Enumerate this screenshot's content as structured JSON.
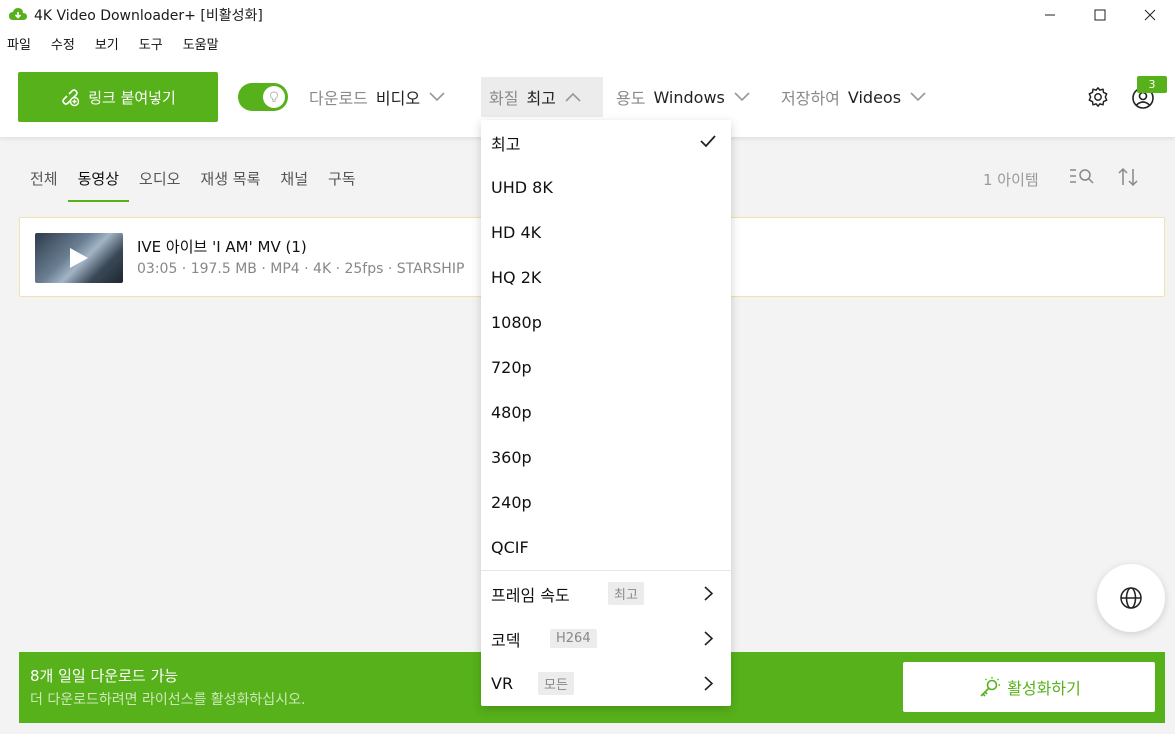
{
  "window": {
    "title": "4K Video Downloader+ [비활성화]",
    "brand_color": "#57b11a"
  },
  "menu": [
    "파일",
    "수정",
    "보기",
    "도구",
    "도움말"
  ],
  "toolbar": {
    "paste_label": "링크 붙여넣기",
    "smart_mode": "on",
    "download_label": "다운로드",
    "download_value": "비디오",
    "quality_label": "화질",
    "quality_value": "최고",
    "purpose_label": "용도",
    "purpose_value": "Windows",
    "save_label": "저장하여",
    "save_value": "Videos",
    "notification_count": "3"
  },
  "tabs": [
    {
      "label": "전체",
      "active": false
    },
    {
      "label": "동영상",
      "active": true
    },
    {
      "label": "오디오",
      "active": false
    },
    {
      "label": "재생 목록",
      "active": false
    },
    {
      "label": "채널",
      "active": false
    },
    {
      "label": "구독",
      "active": false
    }
  ],
  "item_count": "1 아이템",
  "items": [
    {
      "title": "IVE 아이브 'I AM' MV (1)",
      "meta": "03:05 · 197.5 MB · MP4 · 4K · 25fps · STARSHIP"
    }
  ],
  "quality_dropdown": {
    "options": [
      "최고",
      "UHD 8K",
      "HD 4K",
      "HQ 2K",
      "1080p",
      "720p",
      "480p",
      "360p",
      "240p",
      "QCIF"
    ],
    "selected": "최고",
    "submenus": [
      {
        "label": "프레임 속도",
        "value": "최고"
      },
      {
        "label": "코덱",
        "value": "H264"
      },
      {
        "label": "VR",
        "value": "모든"
      }
    ]
  },
  "banner": {
    "title": "8개 일일 다운로드 가능",
    "subtitle": "더 다운로드하려면 라이선스를 활성화하십시오.",
    "activate_label": "활성화하기"
  }
}
